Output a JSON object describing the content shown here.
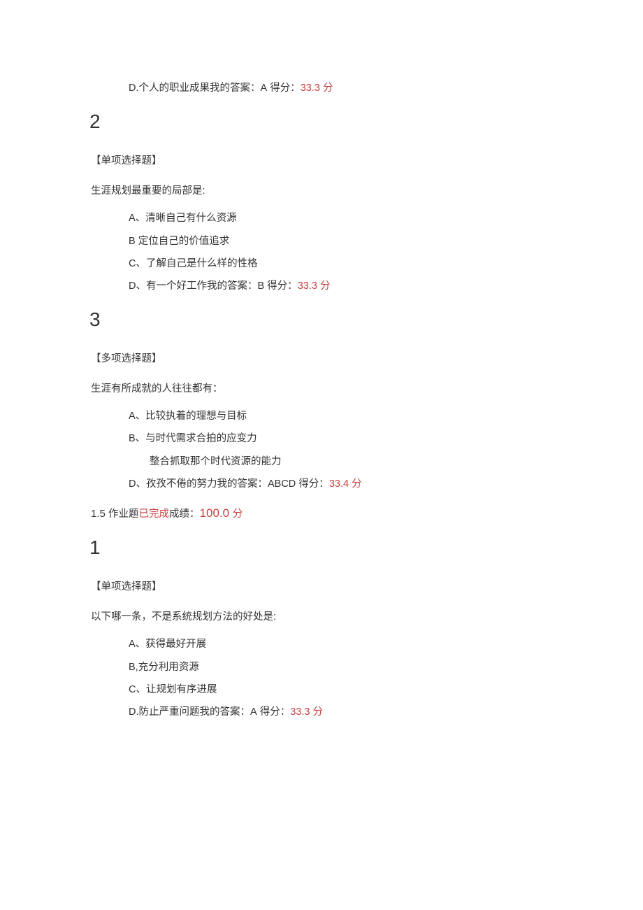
{
  "q_top": {
    "optD_label": "D.",
    "optD_text": "个人的职业成果我的答案：",
    "answer_letter": "A",
    "score_label": " 得分：",
    "score_value": "33.3 ",
    "score_unit": "分"
  },
  "q2": {
    "number": "2",
    "type": "【单项选择题】",
    "text": "生涯规划最重要的局部是:",
    "A_label": "A、",
    "A_text": "清晰自己有什么资源",
    "B_label": "B ",
    "B_text": "定位自己的价值追求",
    "C_label": "C、",
    "C_text": "了解自己是什么样的性格",
    "D_label": "D、",
    "D_text": "有一个好工作我的答案：",
    "answer_letter": "B",
    "score_label": " 得分：",
    "score_value": "33.3 ",
    "score_unit": "分"
  },
  "q3": {
    "number": "3",
    "type": "【多项选择题】",
    "text": "生涯有所成就的人往往都有：",
    "A_label": "A、",
    "A_text": "比较执着的理想与目标",
    "B_label": "B、",
    "B_text": "与时代需求合拍的应变力",
    "C_text": "整合抓取那个时代资源的能力",
    "D_label": "D、",
    "D_text": "孜孜不倦的努力我的答案：",
    "answer_letter": "ABCD",
    "score_label": " 得分：",
    "score_value": "33.4 ",
    "score_unit": "分"
  },
  "hw": {
    "num": "1.5 ",
    "label1": "作业题",
    "done": "已完成",
    "label2": "成绩：",
    "score": "100.0 ",
    "unit": "分"
  },
  "q1b": {
    "number": "1",
    "type": "【单项选择题】",
    "text": "以下哪一条，不是系统规划方法的好处是:",
    "A_label": "A、",
    "A_text": "获得最好开展",
    "B_label": "B,",
    "B_text": "充分利用资源",
    "C_label": "C、",
    "C_text": "让规划有序进展",
    "D_label": "D.",
    "D_text": "防止严重问题我的答案：",
    "answer_letter": "A",
    "score_label": " 得分：",
    "score_value": "33.3 ",
    "score_unit": "分"
  }
}
